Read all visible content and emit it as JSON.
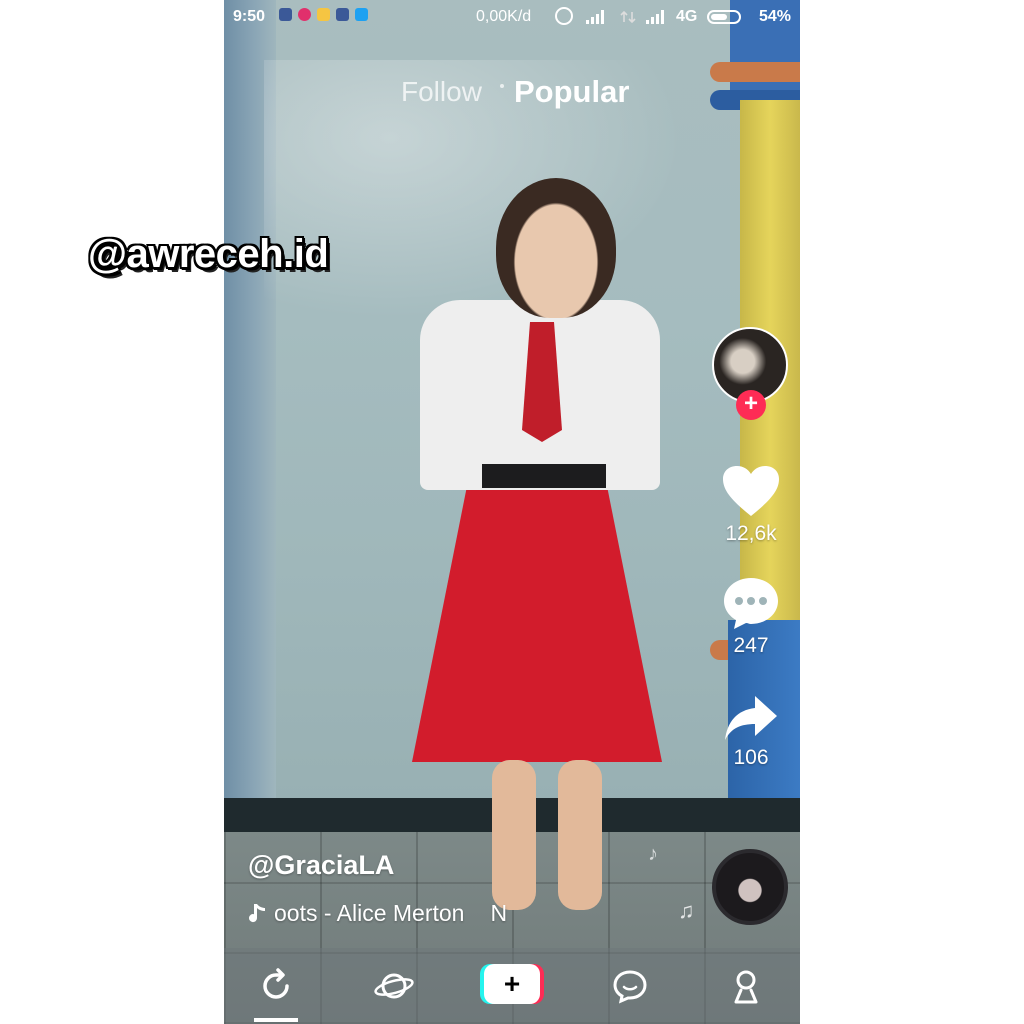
{
  "watermark": "@awreceh.id",
  "status_bar": {
    "time": "9:50",
    "speed": "0,00K/d",
    "network": "4G",
    "battery": "54%",
    "app_icons": [
      "facebook-icon",
      "instagram-icon",
      "message-icon",
      "facebook-icon",
      "twitter-icon"
    ]
  },
  "tabs": {
    "follow": "Follow",
    "popular": "Popular"
  },
  "actions": {
    "likes": "12,6k",
    "comments": "247",
    "shares": "106"
  },
  "video": {
    "username": "@GraciaLA",
    "music": "oots - Alice Merton",
    "music_extra": "N"
  },
  "nav": {
    "items": [
      "home-icon",
      "discover-icon",
      "create-icon",
      "inbox-icon",
      "profile-icon"
    ],
    "create_label": "+"
  },
  "colors": {
    "accent_red": "#fe2c55",
    "accent_cyan": "#25f4ee"
  }
}
